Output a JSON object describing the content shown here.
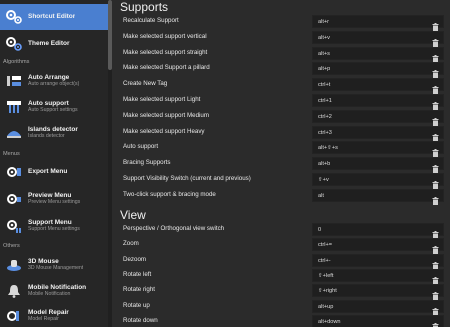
{
  "sidebar": {
    "items": [
      {
        "title": "Shortcut Editor",
        "sub": "",
        "icon": "gear-cogs-icon",
        "active": true
      },
      {
        "title": "Theme Editor",
        "sub": "",
        "icon": "gear-palette-icon",
        "active": false
      },
      {
        "title": "Auto Arrange",
        "sub": "Auto arrange object(s)",
        "icon": "arrange-icon",
        "active": false
      },
      {
        "title": "Auto support",
        "sub": "Auto Support settings",
        "icon": "auto-support-icon",
        "active": false
      },
      {
        "title": "Islands detector",
        "sub": "Islands detector",
        "icon": "islands-icon",
        "active": false
      },
      {
        "title": "Export Menu",
        "sub": "",
        "icon": "export-gear-icon",
        "active": false
      },
      {
        "title": "Preview Menu",
        "sub": "Preview Menu settings",
        "icon": "preview-gear-icon",
        "active": false
      },
      {
        "title": "Support Menu",
        "sub": "Support Menu settings",
        "icon": "support-gear-icon",
        "active": false
      },
      {
        "title": "3D Mouse",
        "sub": "3D Mouse Management",
        "icon": "mouse-3d-icon",
        "active": false
      },
      {
        "title": "Mobile Notification",
        "sub": "Mobile Notification",
        "icon": "bell-icon",
        "active": false
      },
      {
        "title": "Model Repair",
        "sub": "Model Repair",
        "icon": "repair-icon",
        "active": false
      }
    ],
    "sections": [
      "Algorithms",
      "Menus",
      "Others"
    ]
  },
  "supports": {
    "heading": "Supports",
    "rows": [
      {
        "label": "Recalculate Support",
        "value": "alt+r"
      },
      {
        "label": "Make selected support vertical",
        "value": "alt+v"
      },
      {
        "label": "Make selected support straight",
        "value": "alt+s"
      },
      {
        "label": "Make selected Support a pillard",
        "value": "alt+p"
      },
      {
        "label": "Create New Tag",
        "value": "ctrl+t"
      },
      {
        "label": "Make selected support Light",
        "value": "ctrl+1"
      },
      {
        "label": "Make selected support Medium",
        "value": "ctrl+2"
      },
      {
        "label": "Make selected support Heavy",
        "value": "ctrl+3"
      },
      {
        "label": "Auto support",
        "value": "alt+⇧+s"
      },
      {
        "label": "Bracing Supports",
        "value": "alt+b"
      },
      {
        "label": "Support Visibility Switch (current and previous)",
        "value": "⇧+v"
      },
      {
        "label": "Two-click support & bracing mode",
        "value": "alt"
      }
    ]
  },
  "view": {
    "heading": "View",
    "rows": [
      {
        "label": "Perspective / Orthogonal view switch",
        "value": "0"
      },
      {
        "label": "Zoom",
        "value": "ctrl+="
      },
      {
        "label": "Dezoom",
        "value": "ctrl+-"
      },
      {
        "label": "Rotate left",
        "value": "⇧+left"
      },
      {
        "label": "Rotate right",
        "value": "⇧+right"
      },
      {
        "label": "Rotate up",
        "value": "alt+up"
      },
      {
        "label": "Rotate down",
        "value": "alt+down"
      }
    ]
  },
  "colors": {
    "accent": "#4a7fd0",
    "sidebar_bg": "#262626",
    "main_bg": "#2b2b2b",
    "field_bg": "#1f1f1f"
  }
}
